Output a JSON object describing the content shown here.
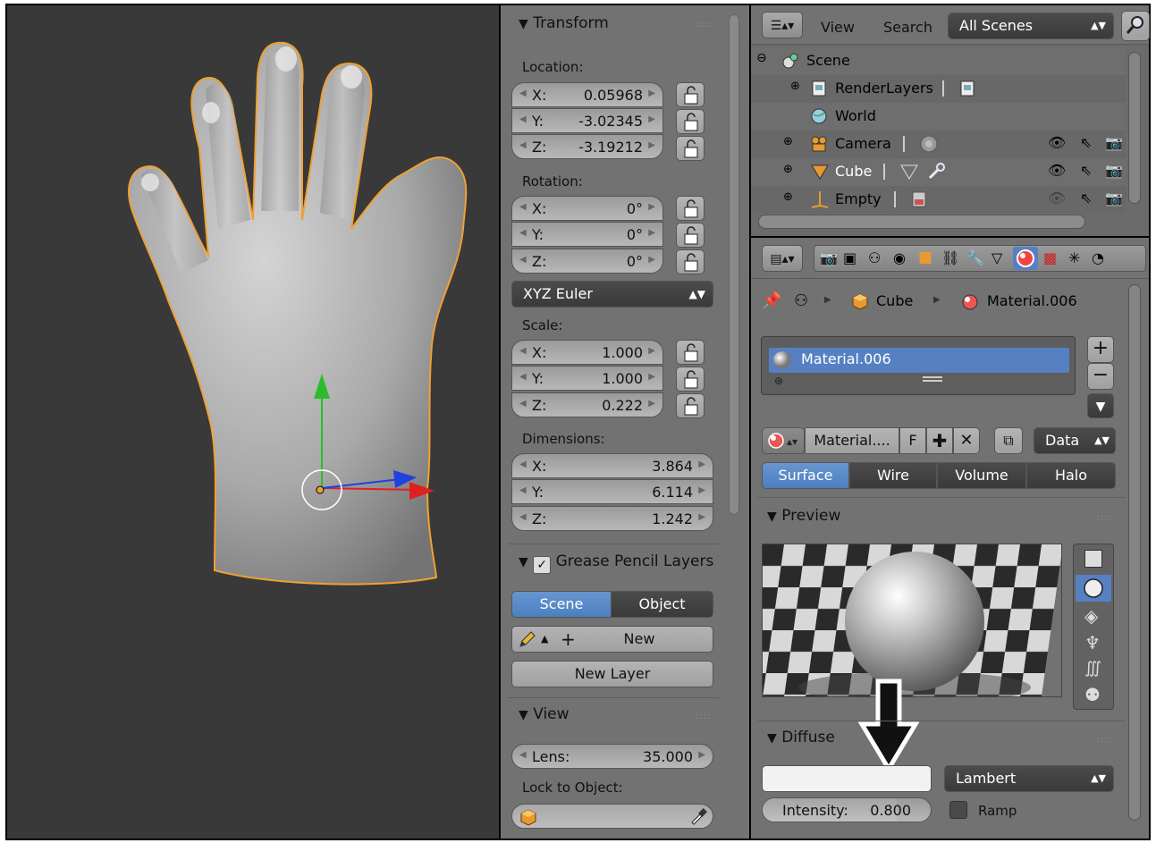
{
  "npanel": {
    "transform_title": "Transform",
    "location_label": "Location:",
    "location": [
      {
        "axis": "X:",
        "value": "0.05968"
      },
      {
        "axis": "Y:",
        "value": "-3.02345"
      },
      {
        "axis": "Z:",
        "value": "-3.19212"
      }
    ],
    "rotation_label": "Rotation:",
    "rotation": [
      {
        "axis": "X:",
        "value": "0°"
      },
      {
        "axis": "Y:",
        "value": "0°"
      },
      {
        "axis": "Z:",
        "value": "0°"
      }
    ],
    "rotation_mode": "XYZ Euler",
    "scale_label": "Scale:",
    "scale": [
      {
        "axis": "X:",
        "value": "1.000"
      },
      {
        "axis": "Y:",
        "value": "1.000"
      },
      {
        "axis": "Z:",
        "value": "0.222"
      }
    ],
    "dimensions_label": "Dimensions:",
    "dimensions": [
      {
        "axis": "X:",
        "value": "3.864"
      },
      {
        "axis": "Y:",
        "value": "6.114"
      },
      {
        "axis": "Z:",
        "value": "1.242"
      }
    ],
    "grease_title": "Grease Pencil Layers",
    "grease_tabs": [
      "Scene",
      "Object"
    ],
    "new_label": "New",
    "new_layer_label": "New Layer",
    "view_title": "View",
    "lens_label": "Lens:",
    "lens_value": "35.000",
    "lock_to_object_label": "Lock to Object:"
  },
  "outliner": {
    "menu_view": "View",
    "menu_search": "Search",
    "scenes_dropdown": "All Scenes",
    "tree": [
      {
        "name": "Scene"
      },
      {
        "name": "RenderLayers"
      },
      {
        "name": "World"
      },
      {
        "name": "Camera"
      },
      {
        "name": "Cube"
      },
      {
        "name": "Empty"
      }
    ]
  },
  "properties": {
    "breadcrumb": [
      "Cube",
      "Material.006"
    ],
    "material_slot": "Material.006",
    "material_name": "Material....",
    "fake_user": "F",
    "link_dropdown": "Data",
    "type_tabs": [
      "Surface",
      "Wire",
      "Volume",
      "Halo"
    ],
    "preview_title": "Preview",
    "diffuse_title": "Diffuse",
    "diffuse_shader": "Lambert",
    "intensity_label": "Intensity:",
    "intensity_value": "0.800",
    "ramp_label": "Ramp"
  },
  "colors": {
    "selection": "#5680c2",
    "viewport_bg": "#393939",
    "panel_bg": "#727272",
    "object_outline": "#f0a030"
  }
}
